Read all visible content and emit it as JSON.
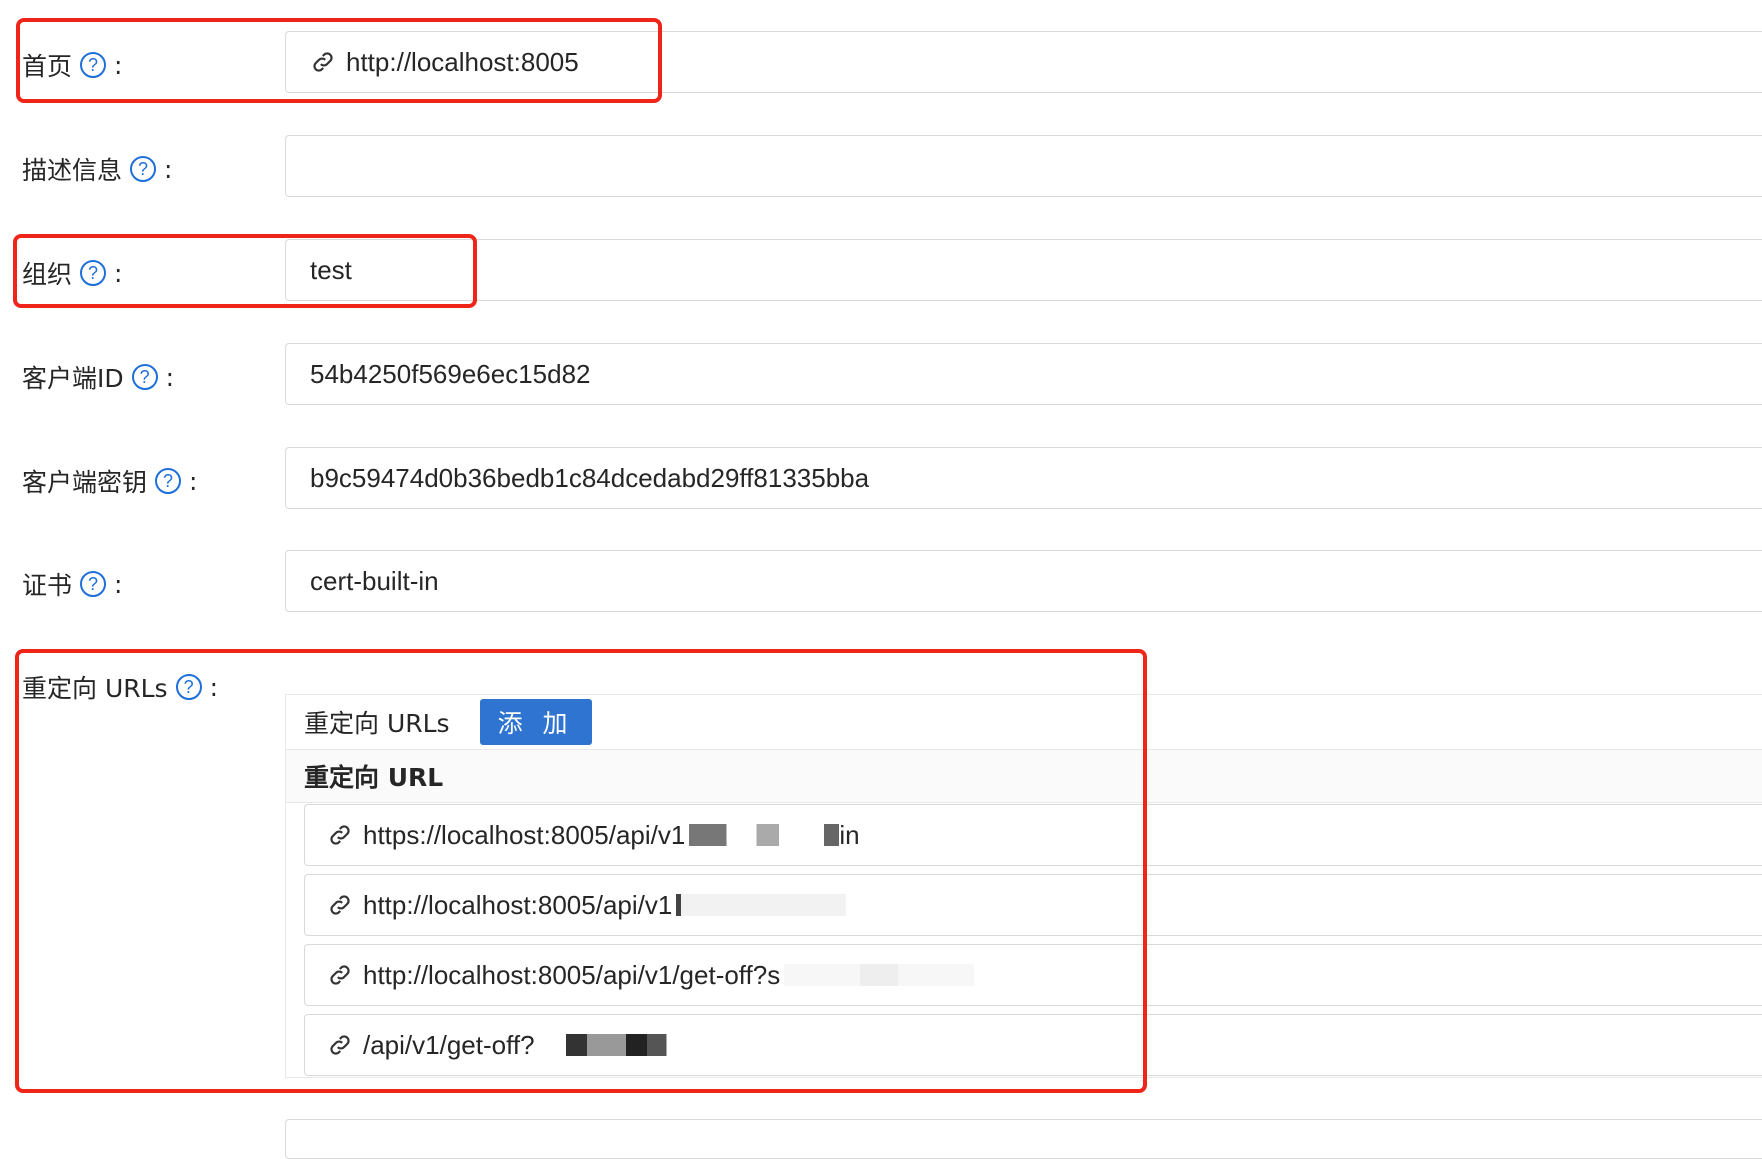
{
  "fields": {
    "homepage": {
      "label": "首页",
      "value": "http://localhost:8005"
    },
    "description": {
      "label": "描述信息",
      "value": ""
    },
    "organization": {
      "label": "组织",
      "value": "test"
    },
    "client_id": {
      "label": "客户端ID",
      "value": "54b4250f569e6ec15d82"
    },
    "client_secret": {
      "label": "客户端密钥",
      "value": "b9c59474d0b36bedb1c84dcedabd29ff81335bba"
    },
    "cert": {
      "label": "证书",
      "value": "cert-built-in"
    },
    "redirect": {
      "label": "重定向 URLs"
    }
  },
  "colon": ":",
  "help_glyph": "?",
  "redirect_panel": {
    "title": "重定向 URLs",
    "add_button": "添 加",
    "column_header": "重定向 URL",
    "urls": [
      {
        "text": "https://localhost:8005/api/v1",
        "suffix": "in"
      },
      {
        "text": "http://localhost:8005/api/v1",
        "suffix": ""
      },
      {
        "text": "http://localhost:8005/api/v1/get-off?s",
        "suffix": ""
      },
      {
        "text": "/api/v1/get-off?",
        "suffix": ""
      }
    ]
  },
  "colors": {
    "accent": "#2f74d0",
    "highlight": "#f0251a",
    "border": "#d9d9d9"
  },
  "icons": {
    "help": "question-circle-icon",
    "link": "link-icon"
  }
}
